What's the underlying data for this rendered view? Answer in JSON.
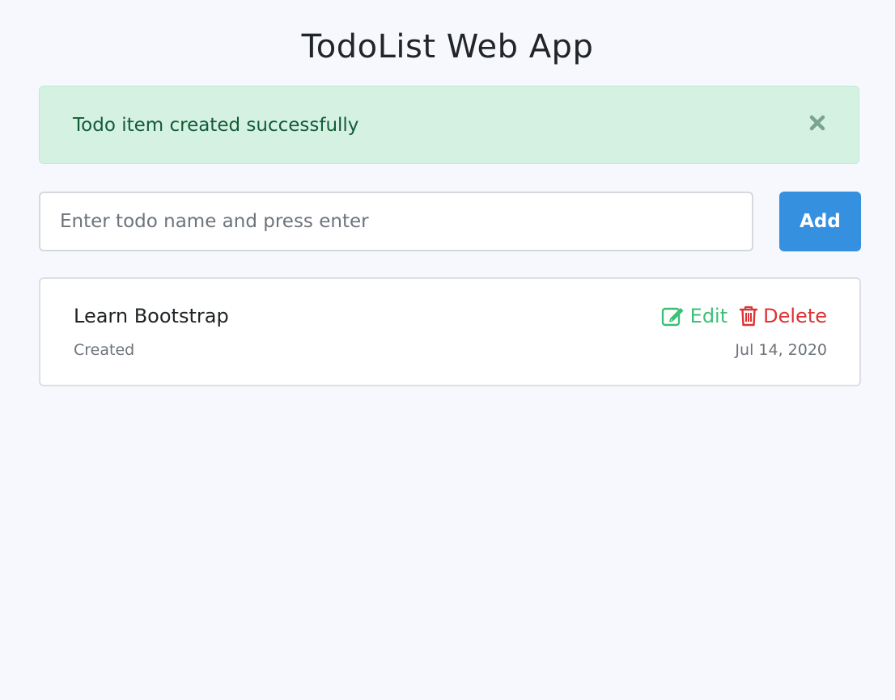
{
  "header": {
    "title": "TodoList Web App"
  },
  "alert": {
    "message": "Todo item created successfully",
    "close_icon": "close-icon"
  },
  "form": {
    "placeholder": "Enter todo name and press enter",
    "value": "",
    "add_label": "Add"
  },
  "todos": [
    {
      "name": "Learn Bootstrap",
      "status": "Created",
      "date": "Jul 14, 2020",
      "edit_label": "Edit",
      "delete_label": "Delete",
      "edit_icon": "edit-icon",
      "delete_icon": "trash-icon"
    }
  ],
  "colors": {
    "background": "#f7f8fd",
    "alert_background": "#d4f1e2",
    "alert_text": "#135c36",
    "primary": "#3590e0",
    "edit": "#3cbf77",
    "delete": "#dc3436",
    "muted": "#6c737b"
  }
}
